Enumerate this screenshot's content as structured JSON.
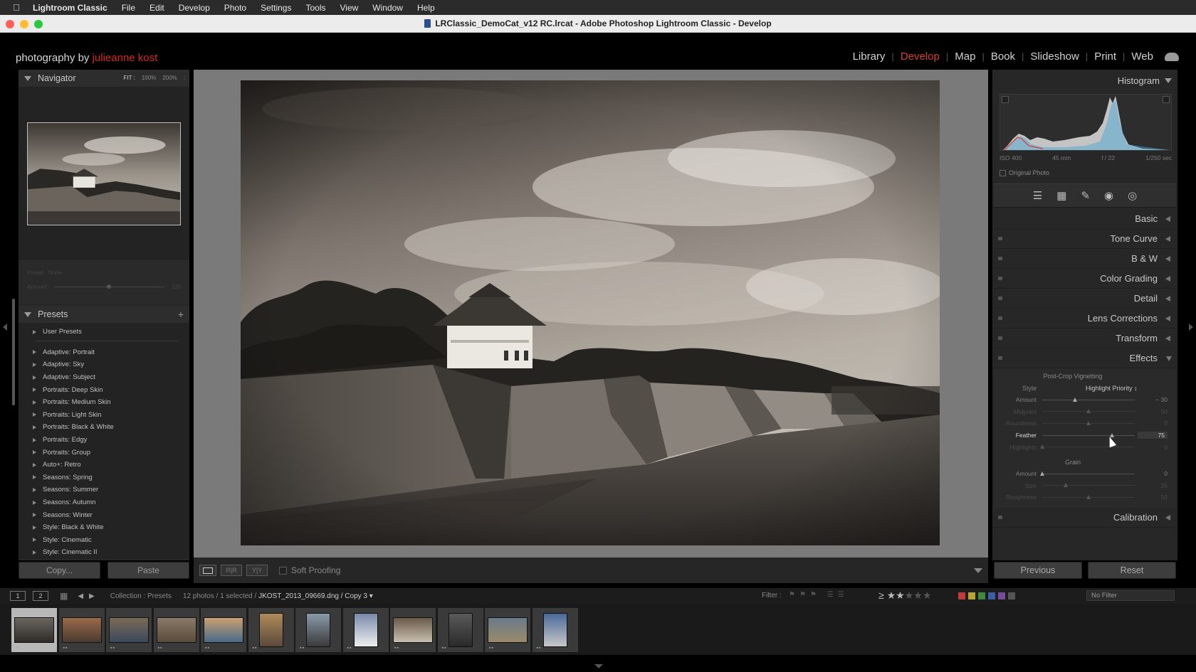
{
  "menubar": {
    "app_name": "Lightroom Classic",
    "items": [
      "File",
      "Edit",
      "Develop",
      "Photo",
      "Settings",
      "Tools",
      "View",
      "Window",
      "Help"
    ]
  },
  "window": {
    "title": "LRClassic_DemoCat_v12 RC.lrcat - Adobe Photoshop Lightroom Classic - Develop"
  },
  "identity": {
    "prefix": "photography by ",
    "name": "julieanne kost"
  },
  "modules": [
    "Library",
    "Develop",
    "Map",
    "Book",
    "Slideshow",
    "Print",
    "Web"
  ],
  "active_module": "Develop",
  "navigator": {
    "title": "Navigator",
    "zoom_options": [
      "FIT :",
      "100%",
      "200%",
      ":"
    ]
  },
  "preset_amount": {
    "preset_label": "Preset : None",
    "amount_label": "Amount",
    "amount_value": "100"
  },
  "presets": {
    "title": "Presets",
    "items": [
      "User Presets",
      "Adaptive: Portrait",
      "Adaptive: Sky",
      "Adaptive: Subject",
      "Portraits: Deep Skin",
      "Portraits: Medium Skin",
      "Portraits: Light Skin",
      "Portraits: Black & White",
      "Portraits: Edgy",
      "Portraits: Group",
      "Auto+: Retro",
      "Seasons: Spring",
      "Seasons: Summer",
      "Seasons: Autumn",
      "Seasons: Winter",
      "Style: Black & White",
      "Style: Cinematic",
      "Style: Cinematic II"
    ]
  },
  "left_buttons": {
    "copy": "Copy...",
    "paste": "Paste"
  },
  "toolbar": {
    "soft_proofing": "Soft Proofing",
    "before_after": "R|R",
    "yy": "Y|Y"
  },
  "histogram": {
    "title": "Histogram",
    "exif": {
      "iso": "ISO 400",
      "focal": "45 mm",
      "aperture": "f / 22",
      "shutter": "1/250 sec"
    },
    "original_photo": "Original Photo"
  },
  "panels": [
    "Basic",
    "Tone Curve",
    "B & W",
    "Color Grading",
    "Detail",
    "Lens Corrections",
    "Transform",
    "Effects",
    "Calibration"
  ],
  "effects": {
    "vignette_title": "Post-Crop Vignetting",
    "style_label": "Style",
    "style_value": "Highlight Priority  ↕",
    "sliders": [
      {
        "label": "Amount",
        "value": "− 30",
        "pos": 0.35
      },
      {
        "label": "Midpoint",
        "value": "50",
        "pos": 0.5
      },
      {
        "label": "Roundness",
        "value": "0",
        "pos": 0.5
      },
      {
        "label": "Feather",
        "value": "75",
        "pos": 0.75
      },
      {
        "label": "Highlights",
        "value": "0",
        "pos": 0.0
      }
    ],
    "grain_title": "Grain",
    "grain": [
      {
        "label": "Amount",
        "value": "0",
        "pos": 0.0
      },
      {
        "label": "Size",
        "value": "25",
        "pos": 0.25
      },
      {
        "label": "Roughness",
        "value": "50",
        "pos": 0.5
      }
    ]
  },
  "right_buttons": {
    "previous": "Previous",
    "reset": "Reset"
  },
  "filmstrip": {
    "view1": "1",
    "view2": "2",
    "collection": "Collection : Presets",
    "count": "12 photos / 1 selected / ",
    "file": "JKOST_2013_09669.dng / Copy 3 ▾",
    "filter_label": "Filter :",
    "no_filter": "No Filter",
    "stars_ge": "≥",
    "thumb_count": 12,
    "colors": [
      "#c23b3b",
      "#b8a433",
      "#3f8a3f",
      "#3a5fa8",
      "#7a4a9a",
      "#555555"
    ]
  }
}
